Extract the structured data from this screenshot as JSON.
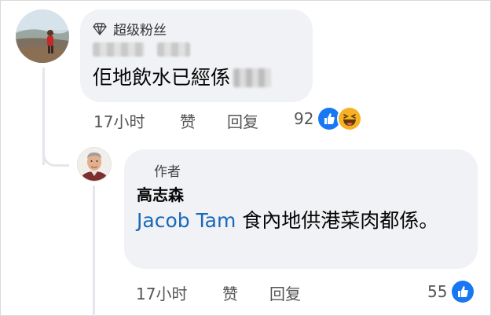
{
  "comment_1": {
    "badge": "超级粉丝",
    "text": "佢地飲水已經係",
    "time": "17小时",
    "like": "赞",
    "reply": "回复",
    "reaction_count": "92"
  },
  "comment_2": {
    "badge": "作者",
    "author": "高志森",
    "mention": "Jacob Tam",
    "text": " 食內地供港菜肉都係。",
    "time": "17小时",
    "like": "赞",
    "reply": "回复",
    "reaction_count": "55"
  },
  "icons": [
    "diamond-icon",
    "like-reaction-icon",
    "haha-reaction-icon"
  ],
  "colors": {
    "like": "#1877f2",
    "haha": "#f7b125",
    "bubble": "#f0f2f5",
    "mention": "#1b68b8"
  }
}
